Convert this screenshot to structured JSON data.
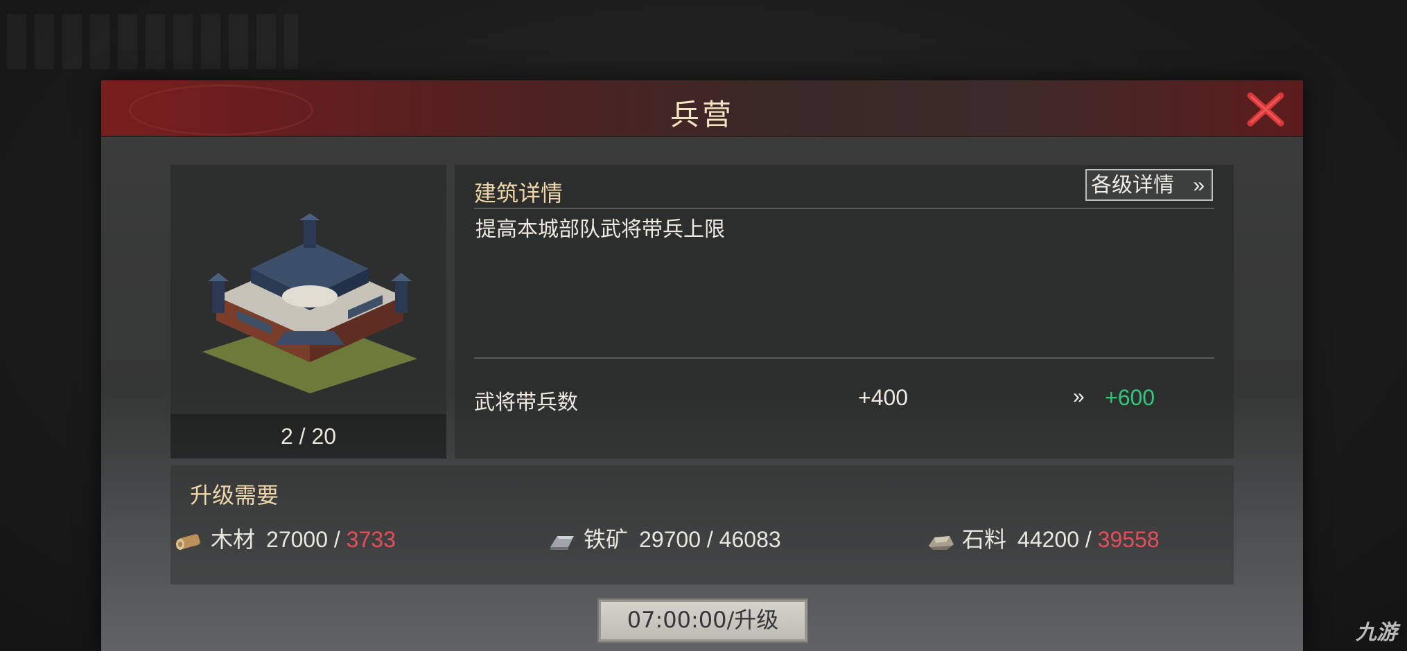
{
  "dialog": {
    "title": "兵营"
  },
  "building": {
    "level": "2 / 20"
  },
  "details": {
    "heading": "建筑详情",
    "levels_button": "各级详情",
    "levels_button_arrow": "»",
    "description": "提高本城部队武将带兵上限",
    "stat": {
      "label": "武将带兵数",
      "current": "+400",
      "arrow": "»",
      "next": "+600"
    }
  },
  "requirements": {
    "title": "升级需要",
    "items": [
      {
        "icon": "wood-icon",
        "name": "木材",
        "required": "27000",
        "separator": " / ",
        "have": "3733",
        "insufficient": true
      },
      {
        "icon": "iron-ore-icon",
        "name": "铁矿",
        "required": "29700",
        "separator": " / ",
        "have": "46083",
        "insufficient": false
      },
      {
        "icon": "stone-icon",
        "name": "石料",
        "required": "44200",
        "separator": " / ",
        "have": "39558",
        "insufficient": true
      }
    ]
  },
  "upgrade_button": "07:00:00/升级",
  "watermark": "九游",
  "colors": {
    "title_bar": "#5a1f1f",
    "positive": "#2fc97a",
    "insufficient": "#e8404a",
    "heading": "#f0d7a6"
  }
}
